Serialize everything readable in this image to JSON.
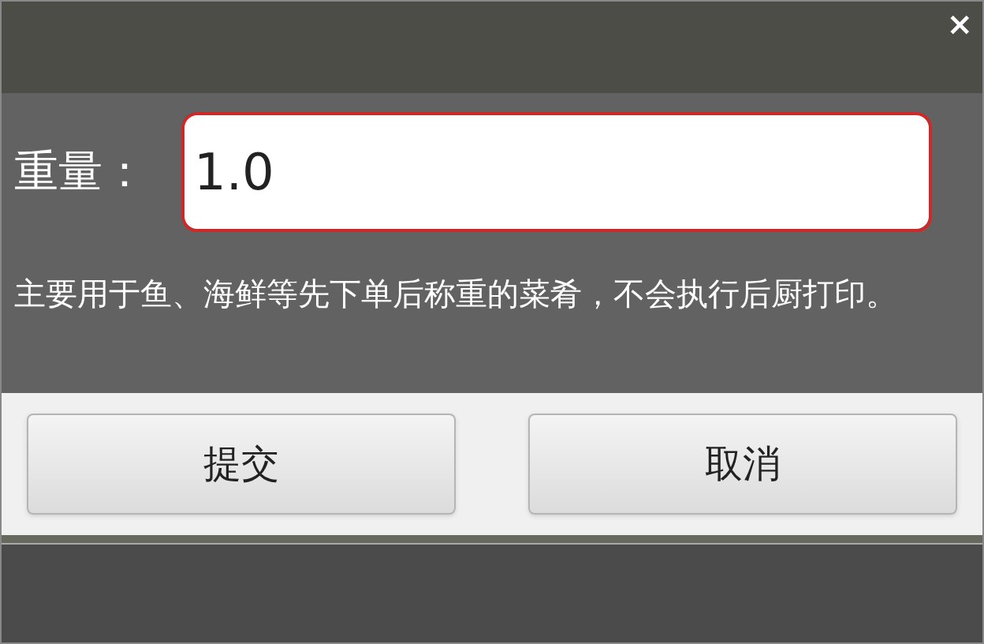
{
  "close": {
    "label": "×"
  },
  "weight": {
    "label": "重量：",
    "value": "1.0"
  },
  "hint": "主要用于鱼、海鲜等先下单后称重的菜肴，不会执行后厨打印。",
  "buttons": [
    {
      "label": "提交"
    },
    {
      "label": "取消"
    }
  ]
}
